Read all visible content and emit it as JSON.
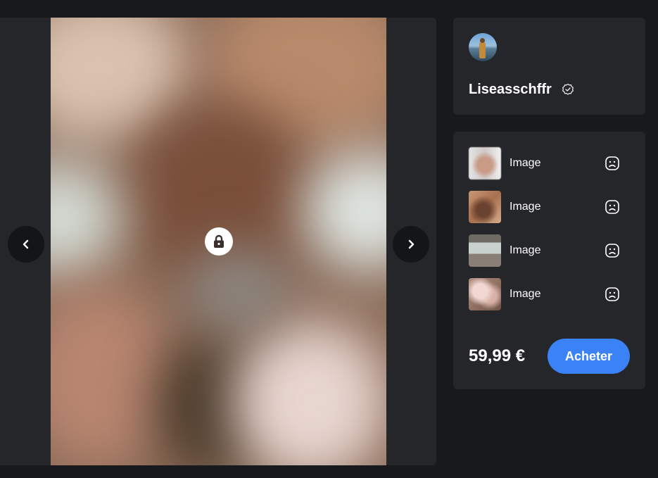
{
  "viewer": {
    "prev_icon": "chevron-left-icon",
    "next_icon": "chevron-right-icon",
    "lock_icon": "lock-icon"
  },
  "profile": {
    "username": "Liseasschffr",
    "verified_icon": "verified-check-icon"
  },
  "pack": {
    "items": [
      {
        "label": "Image",
        "status_icon": "sad-face-icon"
      },
      {
        "label": "Image",
        "status_icon": "sad-face-icon"
      },
      {
        "label": "Image",
        "status_icon": "sad-face-icon"
      },
      {
        "label": "Image",
        "status_icon": "sad-face-icon"
      }
    ],
    "price": "59,99 €",
    "buy_label": "Acheter"
  },
  "colors": {
    "background": "#18191d",
    "card": "#25262a",
    "accent": "#3b82f6"
  }
}
